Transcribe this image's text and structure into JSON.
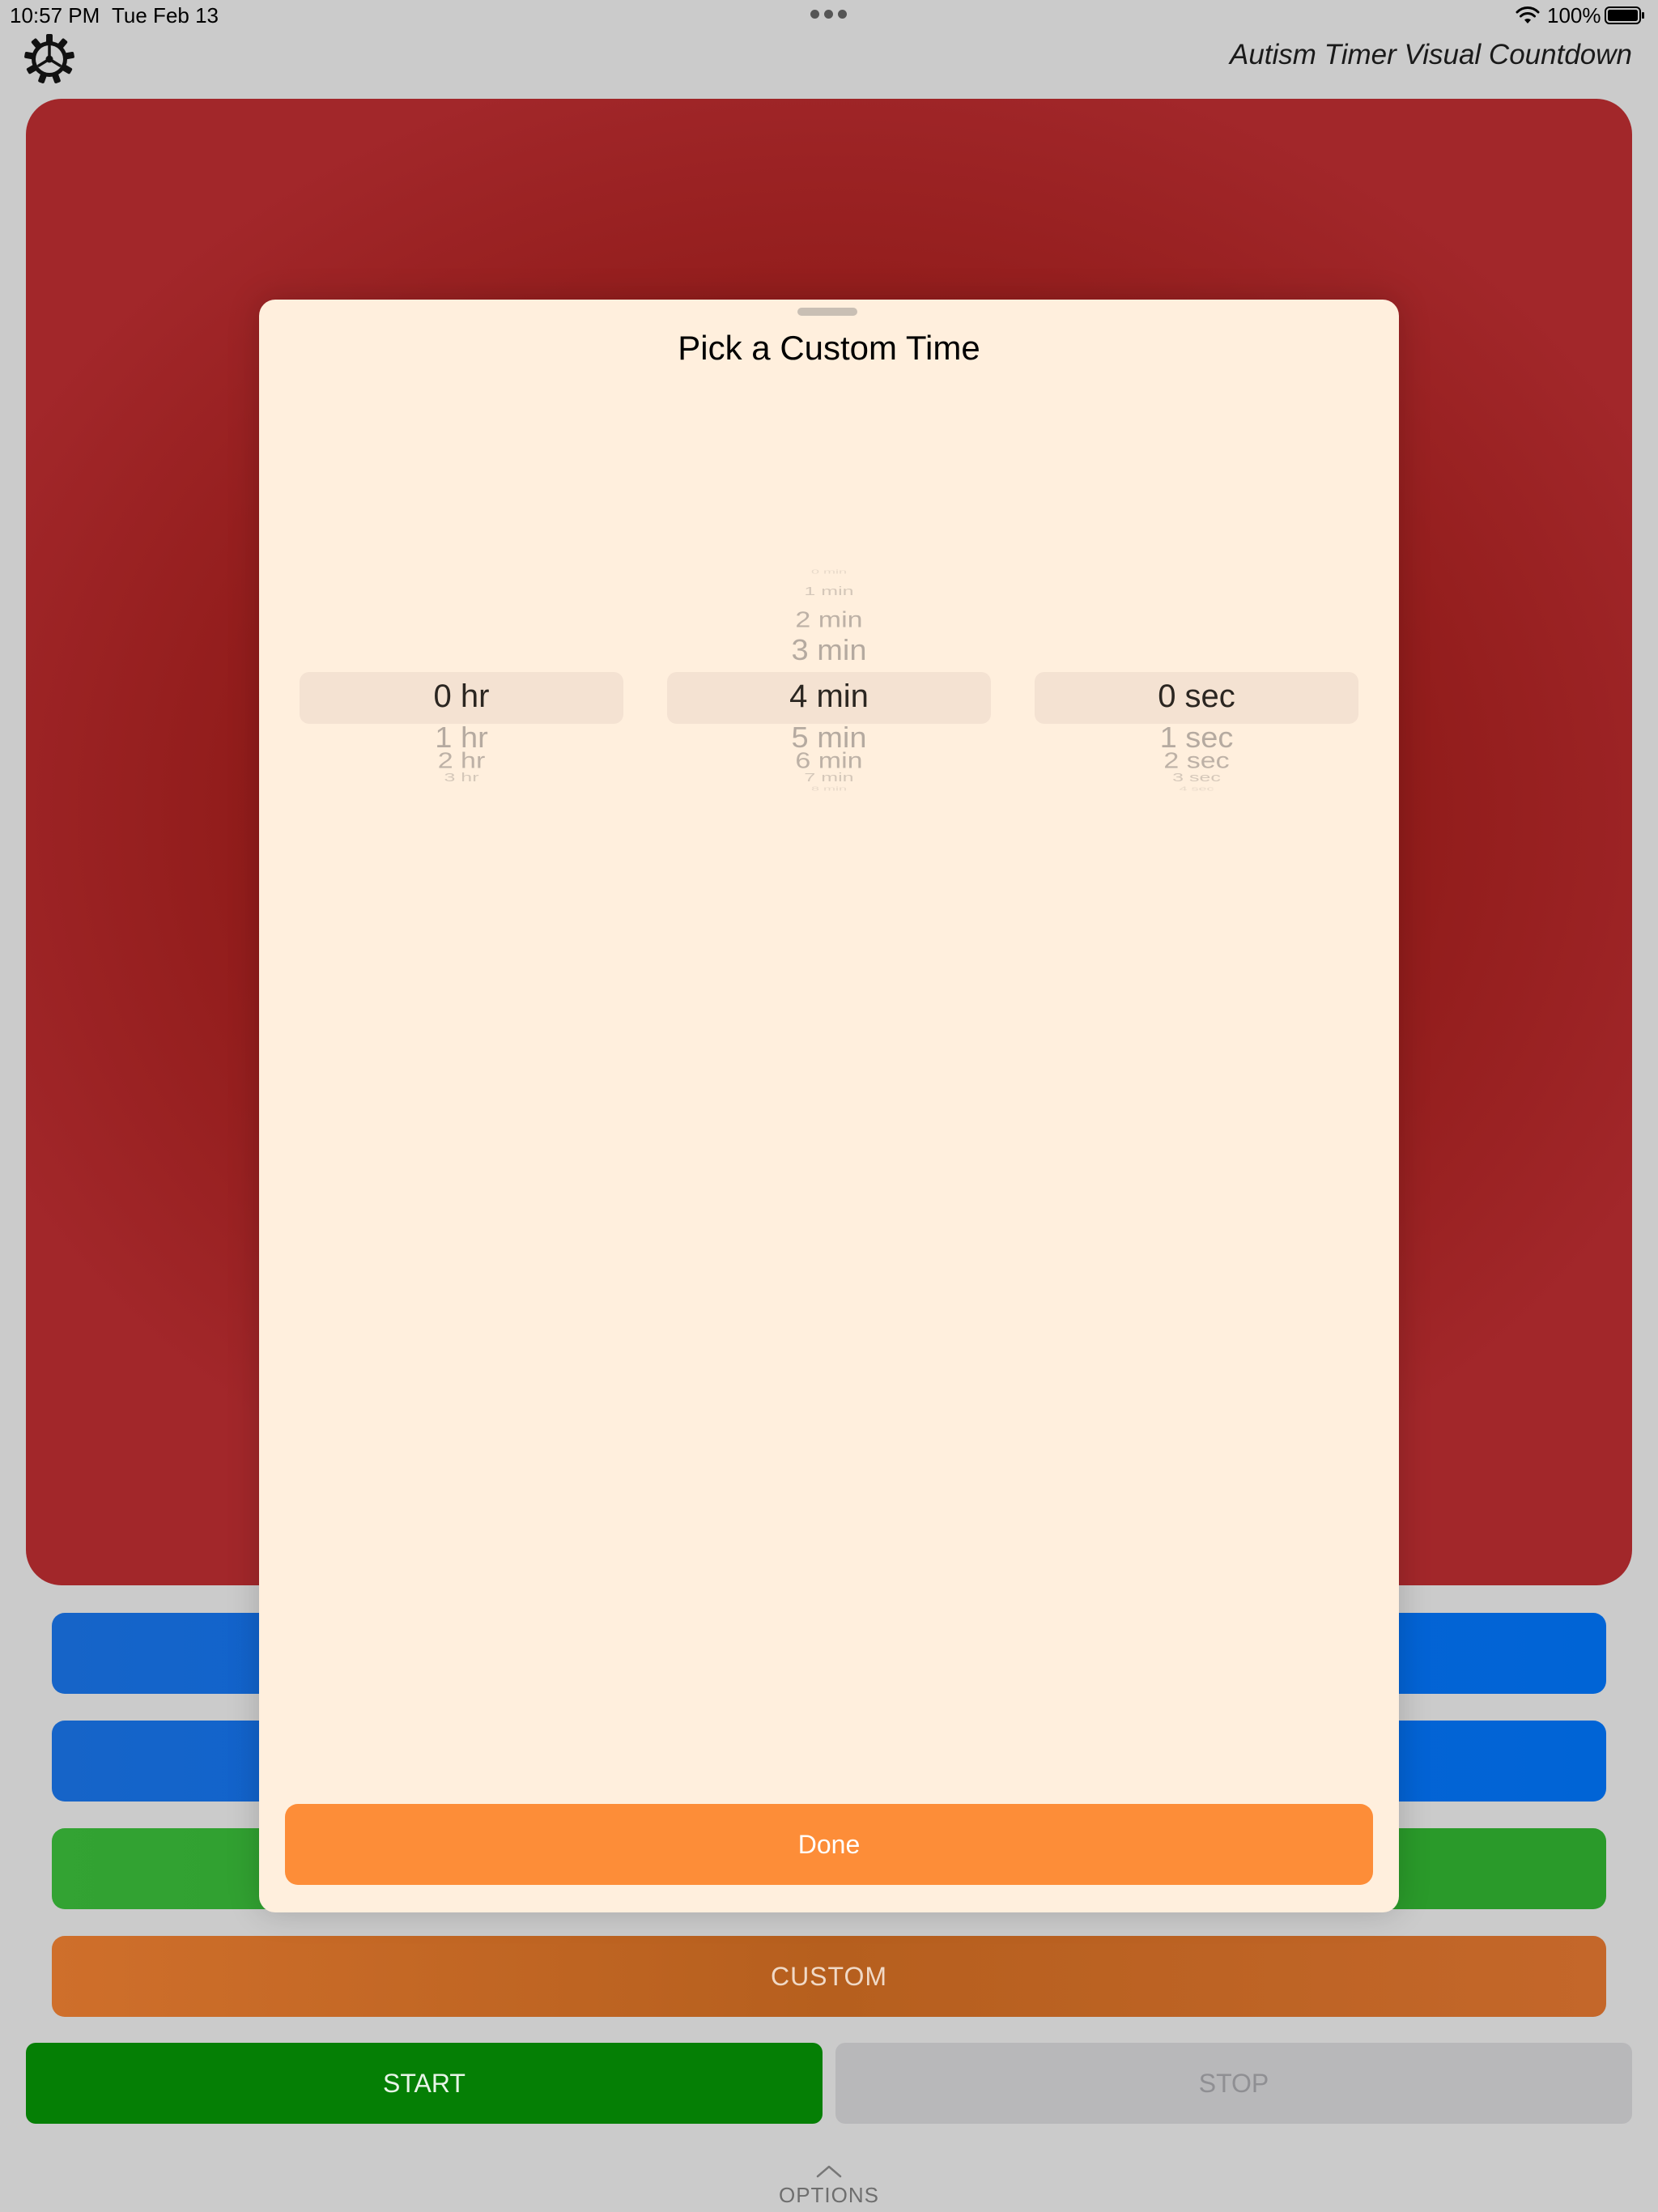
{
  "status_bar": {
    "time": "10:57 PM",
    "date": "Tue Feb 13",
    "battery": "100%"
  },
  "header": {
    "app_title": "Autism Timer Visual Countdown",
    "settings_icon": "gear-icon"
  },
  "colors": {
    "timer_red": "#a2272a",
    "preset_blue": "#0a62d3",
    "preset_green": "#2a9a2a",
    "custom_orange": "#b65f1e",
    "start_green": "#057f05",
    "stop_gray": "#b8b8ba",
    "modal_bg": "#ffefdd",
    "done_orange": "#fd8d38"
  },
  "controls": {
    "custom_label": "CUSTOM",
    "start_label": "START",
    "stop_label": "STOP",
    "options_label": "OPTIONS"
  },
  "modal": {
    "title": "Pick a Custom Time",
    "done_label": "Done",
    "hours": {
      "items": [
        "0 hr",
        "1 hr",
        "2 hr",
        "3 hr"
      ],
      "selected": "0 hr"
    },
    "minutes": {
      "items": [
        "0 min",
        "1 min",
        "2 min",
        "3 min",
        "4 min",
        "5 min",
        "6 min",
        "7 min",
        "8 min"
      ],
      "selected": "4 min"
    },
    "seconds": {
      "items": [
        "0 sec",
        "1 sec",
        "2 sec",
        "3 sec",
        "4 sec"
      ],
      "selected": "0 sec"
    }
  }
}
